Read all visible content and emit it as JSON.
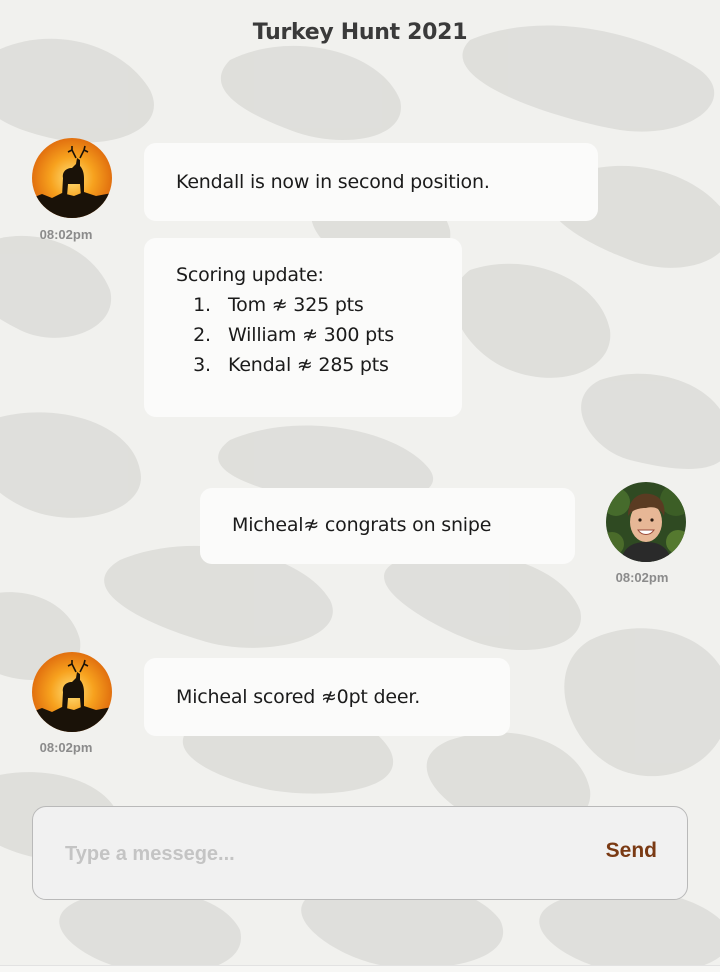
{
  "header": {
    "title": "Turkey Hunt 2021"
  },
  "messages": [
    {
      "side": "left",
      "time": "08:02pm",
      "avatar": "deer-silhouette-avatar",
      "text": "Kendall is now in second position."
    },
    {
      "side": "left",
      "heading": "Scoring update:",
      "list": [
        {
          "num": "1.",
          "text": "Tom ≉ 325 pts"
        },
        {
          "num": "2.",
          "text": "William ≉ 300 pts"
        },
        {
          "num": "3.",
          "text": "Kendal ≉ 285 pts"
        }
      ]
    },
    {
      "side": "right",
      "time": "08:02pm",
      "avatar": "young-man-photo-avatar",
      "text": "Micheal≉ congrats on snipe"
    },
    {
      "side": "left",
      "time": "08:02pm",
      "avatar": "deer-silhouette-avatar",
      "text": "Micheal scored ≉0pt deer."
    }
  ],
  "composer": {
    "placeholder": "Type a messege...",
    "value": "",
    "send_label": "Send"
  },
  "colors": {
    "send": "#7a3a14",
    "bubble": "#fbfbfa",
    "background": "#f1f1ee"
  }
}
